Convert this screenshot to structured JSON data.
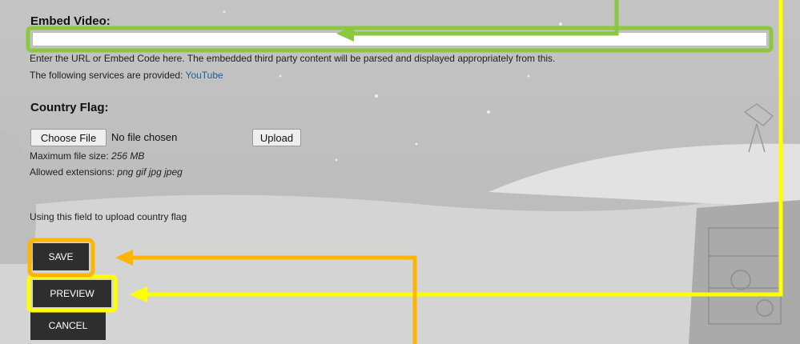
{
  "embed_video": {
    "label": "Embed Video:",
    "value": "",
    "help_line1": "Enter the URL or Embed Code here. The embedded third party content will be parsed and displayed appropriately from this.",
    "services_prefix": "The following services are provided: ",
    "services_link": "YouTube"
  },
  "country_flag": {
    "label": "Country Flag:",
    "choose_file_label": "Choose File",
    "no_file_text": "No file chosen",
    "upload_label": "Upload",
    "max_size_prefix": "Maximum file size: ",
    "max_size_value": "256 MB",
    "allowed_prefix": "Allowed extensions: ",
    "allowed_value": "png gif jpg jpeg",
    "description": "Using this field to upload country flag"
  },
  "actions": {
    "save_label": "SAVE",
    "preview_label": "PREVIEW",
    "cancel_label": "CANCEL"
  },
  "colors": {
    "annotation_green": "#8dc63f",
    "annotation_yellow": "#ffff00",
    "annotation_orange": "#ffb400",
    "link_blue": "#1f5fa5"
  }
}
